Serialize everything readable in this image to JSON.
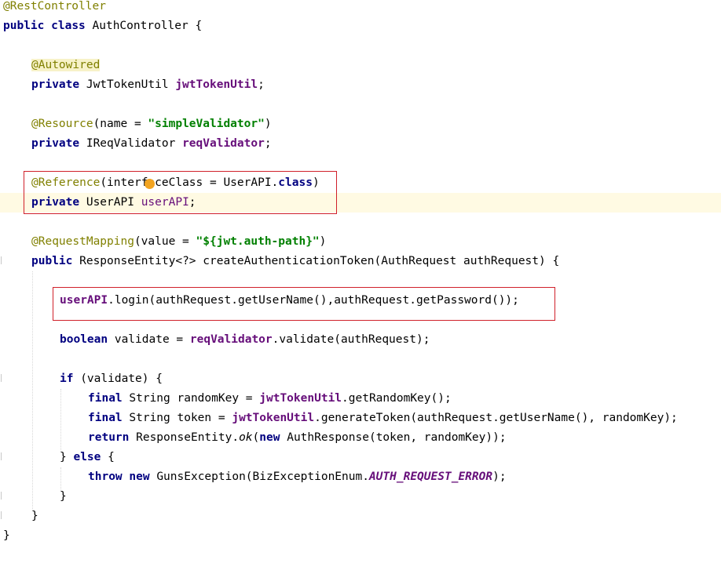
{
  "editor": {
    "lines": {
      "l1": {
        "ann": "@RestController"
      },
      "l2": {
        "kw1": "public",
        "kw2": "class",
        "rest": " AuthController {"
      },
      "l4": {
        "ann": "@Autowired"
      },
      "l5": {
        "kw": "private",
        "mid": " JwtTokenUtil ",
        "field": "jwtTokenUtil",
        "end": ";"
      },
      "l7": {
        "ann": "@Resource",
        "mid": "(name = ",
        "str": "\"simpleValidator\"",
        "end": ")"
      },
      "l8": {
        "kw": "private",
        "mid": " IReqValidator ",
        "field": "reqValidator",
        "end": ";"
      },
      "l10": {
        "ann": "@Reference",
        "mid": "(interfaceClass = UserAPI.",
        "kw": "class",
        "end": ")"
      },
      "l11": {
        "kw": "private",
        "mid": " UserAPI ",
        "field": "userAPI",
        "end": ";"
      },
      "l13": {
        "ann": "@RequestMapping",
        "mid": "(value = ",
        "str": "\"${jwt.auth-path}\"",
        "end": ")"
      },
      "l14": {
        "kw": "public",
        "rest": " ResponseEntity<?> createAuthenticationToken(AuthRequest authRequest) {"
      },
      "l16": {
        "field": "userAPI",
        "rest": ".login(authRequest.getUserName(),authRequest.getPassword());"
      },
      "l18": {
        "kw": "boolean",
        "mid": " validate = ",
        "field": "reqValidator",
        "end": ".validate(authRequest);"
      },
      "l20": {
        "kw": "if",
        "rest": " (validate) {"
      },
      "l21": {
        "kw": "final",
        "mid": " String randomKey = ",
        "field": "jwtTokenUtil",
        "end": ".getRandomKey();"
      },
      "l22": {
        "kw": "final",
        "mid": " String token = ",
        "field": "jwtTokenUtil",
        "end": ".generateToken(authRequest.getUserName(), randomKey);"
      },
      "l23": {
        "kw": "return",
        "mid": " ResponseEntity.",
        "method": "ok",
        "mid2": "(",
        "kw2": "new",
        "end": " AuthResponse(token, randomKey));"
      },
      "l24": {
        "pre": "} ",
        "kw": "else",
        "end": " {"
      },
      "l25": {
        "kw1": "throw",
        "kw2": "new",
        "mid": " GunsException(BizExceptionEnum.",
        "const": "AUTH_REQUEST_ERROR",
        "end": ");"
      },
      "l26": {
        "text": "}"
      },
      "l27": {
        "text": "}"
      },
      "l28": {
        "text": "}"
      }
    },
    "colors": {
      "keyword": "#000080",
      "annotation": "#808000",
      "field": "#660e7a",
      "string": "#008000",
      "highlight_box": "#d0202a",
      "caret_row": "#fffae3",
      "intention_bulb": "#f2a421"
    },
    "icons": [
      "intention-bulb-icon",
      "fold-marker-icon"
    ]
  }
}
